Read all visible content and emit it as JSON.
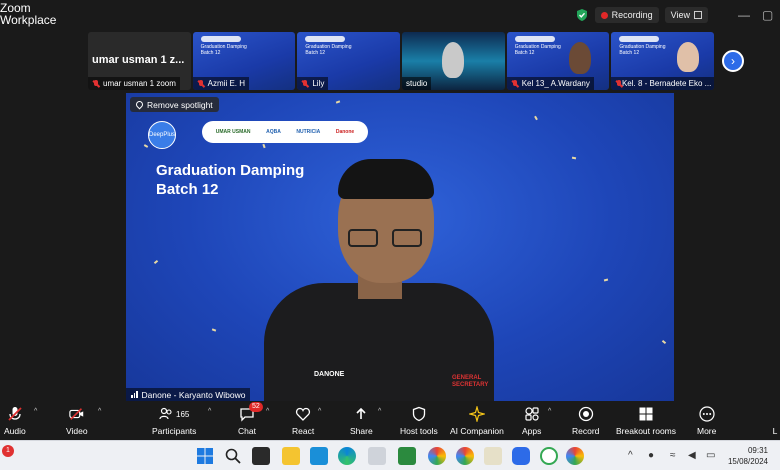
{
  "window": {
    "app_title": "Zoom Workplace",
    "recording_label": "Recording",
    "view_label": "View"
  },
  "thumbnails": [
    {
      "big_name": "umar usman 1 z...",
      "label": "umar usman 1 zoom",
      "muted": true,
      "style": "dark"
    },
    {
      "label": "Azmii E. H",
      "muted": true,
      "style": "blue",
      "slide_title": "Graduation Damping Batch 12"
    },
    {
      "label": "Lily",
      "muted": true,
      "style": "blue",
      "slide_title": "Graduation Damping Batch 12"
    },
    {
      "label": "studio",
      "muted": false,
      "style": "studio"
    },
    {
      "label": "Kel 13_ A.Wardany",
      "muted": true,
      "style": "blue",
      "slide_title": "Graduation Damping Batch 12"
    },
    {
      "label": "Kel. 8 - Bernadete Eko ...",
      "muted": true,
      "style": "blue",
      "slide_title": "Graduation Damping Batch 12"
    }
  ],
  "main": {
    "spotlight_button": "Remove spotlight",
    "logo_text": "DeepPlus",
    "sponsors": [
      "UMAR USMAN",
      "AQBA",
      "NUTRICIA",
      "Danone"
    ],
    "event_title_line1": "Graduation Damping",
    "event_title_line2": "Batch 12",
    "shirt_brand": "DANONE",
    "shirt_badge": "GENERAL SECRETARY",
    "speaker_name": "Danone - Karyanto Wibowo"
  },
  "toolbar": {
    "audio": "Audio",
    "video": "Video",
    "participants": "Participants",
    "participants_count": "165",
    "chat": "Chat",
    "chat_badge": "52",
    "react": "React",
    "share": "Share",
    "host_tools": "Host tools",
    "ai_companion": "AI Companion",
    "apps": "Apps",
    "record": "Record",
    "breakout_rooms": "Breakout rooms",
    "more": "More",
    "leave": "L"
  },
  "taskbar": {
    "time": "09:31",
    "date": "15/08/2024",
    "notif_count": "1"
  }
}
